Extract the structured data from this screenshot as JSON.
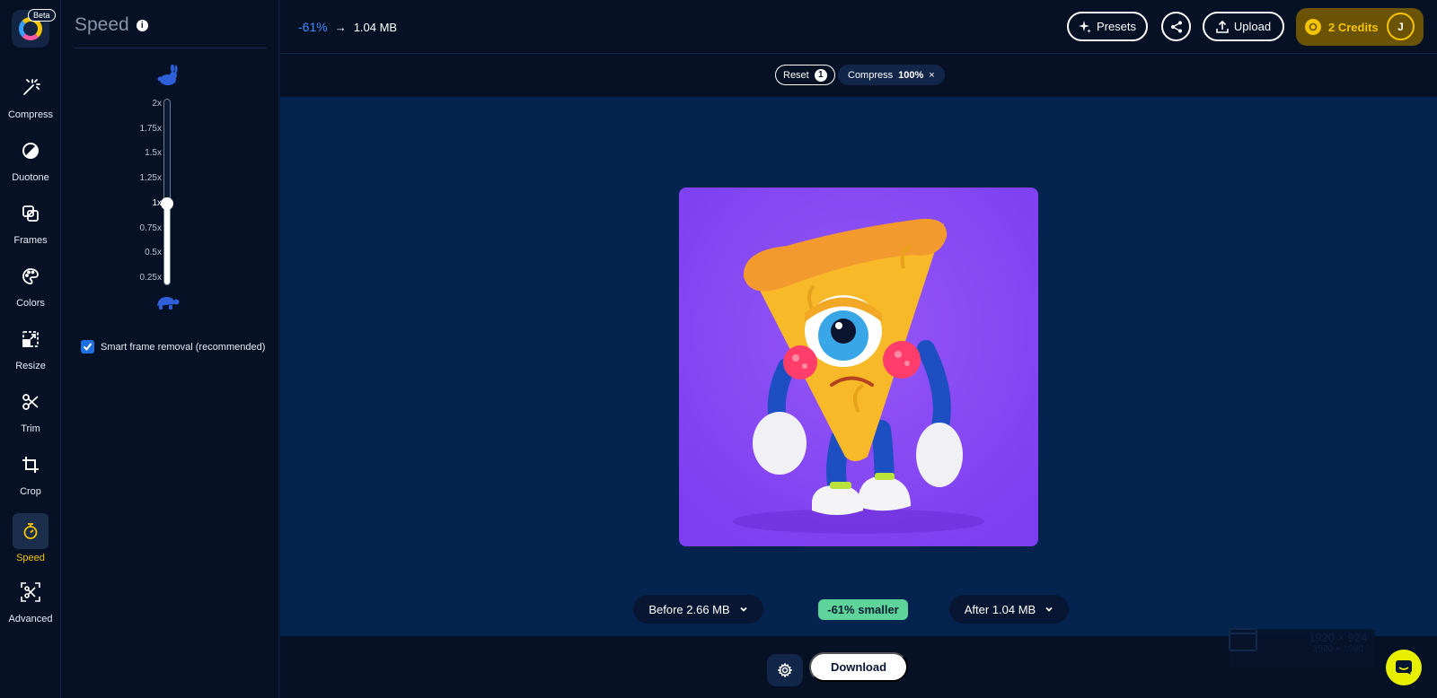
{
  "brand": {
    "badge": "Beta",
    "logo_icon": "app-logo-icon"
  },
  "tools": [
    {
      "label": "Compress",
      "icon": "magic-wand-icon",
      "active": false
    },
    {
      "label": "Duotone",
      "icon": "duotone-icon",
      "active": false
    },
    {
      "label": "Frames",
      "icon": "frames-icon",
      "active": false
    },
    {
      "label": "Colors",
      "icon": "palette-icon",
      "active": false
    },
    {
      "label": "Resize",
      "icon": "resize-icon",
      "active": false
    },
    {
      "label": "Trim",
      "icon": "scissors-icon",
      "active": false
    },
    {
      "label": "Crop",
      "icon": "crop-icon",
      "active": false
    },
    {
      "label": "Speed",
      "icon": "stopwatch-icon",
      "active": true
    },
    {
      "label": "Advanced",
      "icon": "advanced-icon",
      "active": false
    }
  ],
  "panel": {
    "title": "Speed",
    "info_icon": "info-icon",
    "fast_icon": "rabbit-icon",
    "slow_icon": "turtle-icon",
    "ticks": [
      "2x",
      "1.75x",
      "1.5x",
      "1.25x",
      "1x",
      "0.75x",
      "0.5x",
      "0.25x"
    ],
    "current": "1x",
    "level_fraction": 0.43,
    "smart_frame_label": "Smart frame removal (recommended)",
    "smart_frame_checked": true
  },
  "topbar": {
    "reduction": "-61%",
    "arrow": "→",
    "size": "1.04 MB",
    "presets": "Presets",
    "upload": "Upload",
    "credits": "2 Credits",
    "avatar": "J"
  },
  "chips": {
    "reset": "Reset",
    "reset_count": "1",
    "compress": "Compress",
    "compress_value": "100%",
    "close": "×"
  },
  "compare": {
    "before": "Before 2.66 MB",
    "badge": "-61% smaller",
    "after": "After 1.04 MB"
  },
  "bottom": {
    "download": "Download",
    "ghost_dims_1": "1920 × 924",
    "ghost_dims_2": "1920 × 1080"
  },
  "colors": {
    "accent_yellow": "#f5c400",
    "accent_blue": "#3a8dff",
    "success_green": "#5fd49a",
    "preview_bg": "#8447f2"
  }
}
